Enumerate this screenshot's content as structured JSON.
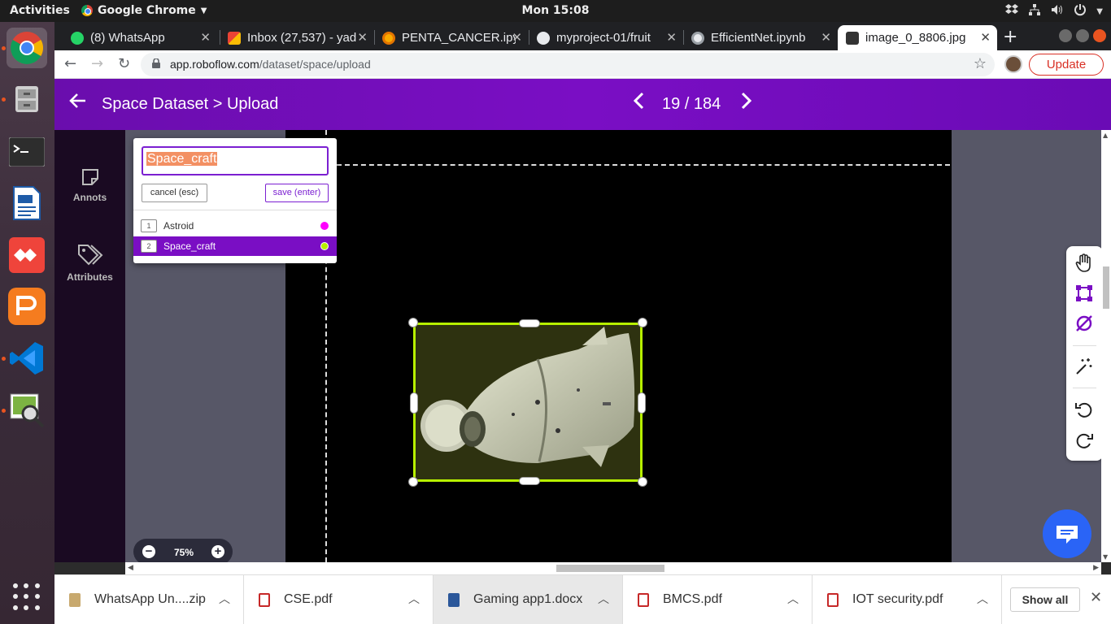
{
  "system": {
    "activities": "Activities",
    "app_name": "Google Chrome",
    "clock": "Mon 15:08"
  },
  "tabs": [
    {
      "title": "(8) WhatsApp",
      "icon": "whatsapp-icon"
    },
    {
      "title": "Inbox (27,537) - yad",
      "icon": "gmail-icon"
    },
    {
      "title": "PENTA_CANCER.ipy",
      "icon": "colab-icon"
    },
    {
      "title": "myproject-01/fruit",
      "icon": "github-icon"
    },
    {
      "title": "EfficientNet.ipynb",
      "icon": "colab-icon"
    },
    {
      "title": "image_0_8806.jpg",
      "icon": "roboflow-icon",
      "active": true
    }
  ],
  "address": {
    "host": "app.roboflow.com",
    "path": "/dataset/space/upload",
    "update_label": "Update"
  },
  "header": {
    "title": "Space Dataset > Upload",
    "counter": "19 / 184"
  },
  "sidebar": {
    "items": [
      {
        "label": "Annots",
        "icon": "annotation-icon"
      },
      {
        "label": "Attributes",
        "icon": "tags-icon"
      }
    ]
  },
  "class_popup": {
    "input_value": "Space_craft",
    "cancel_label": "cancel (esc)",
    "save_label": "save (enter)",
    "classes": [
      {
        "num": "1",
        "name": "Astroid",
        "color": "#ff00ff"
      },
      {
        "num": "2",
        "name": "Space_craft",
        "color": "#b7f000",
        "selected": true
      }
    ]
  },
  "zoom": {
    "value": "75%"
  },
  "colors": {
    "brand_purple": "#7a0ec4",
    "bbox": "#b7f000",
    "chat": "#2a64f6"
  },
  "downloads": {
    "items": [
      {
        "name": "WhatsApp Un....zip",
        "icon": "zip-icon"
      },
      {
        "name": "CSE.pdf",
        "icon": "pdf-icon"
      },
      {
        "name": "Gaming app1.docx",
        "icon": "docx-icon"
      },
      {
        "name": "BMCS.pdf",
        "icon": "pdf-icon"
      },
      {
        "name": "IOT security.pdf",
        "icon": "pdf-icon"
      }
    ],
    "show_all": "Show all"
  }
}
